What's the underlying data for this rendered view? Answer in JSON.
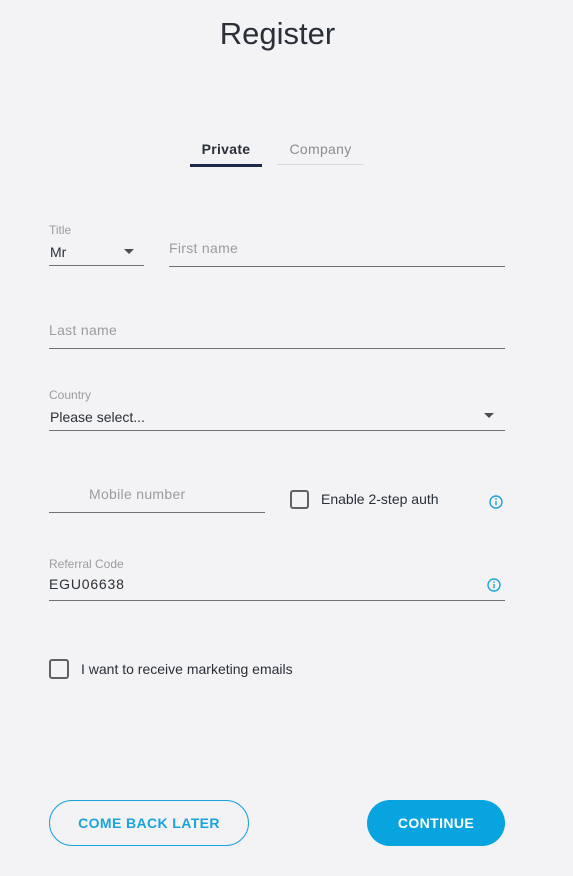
{
  "page": {
    "title": "Register"
  },
  "tabs": [
    {
      "label": "Private",
      "active": true
    },
    {
      "label": "Company",
      "active": false
    }
  ],
  "form": {
    "title_field": {
      "label": "Title",
      "value": "Mr"
    },
    "first_name": {
      "placeholder": "First name"
    },
    "last_name": {
      "placeholder": "Last name"
    },
    "country": {
      "label": "Country",
      "value": "Please select..."
    },
    "mobile": {
      "placeholder": "Mobile number"
    },
    "two_step": {
      "label": "Enable 2-step auth",
      "checked": false,
      "icon": "info-icon"
    },
    "referral": {
      "label": "Referral Code",
      "value": "EGU06638",
      "icon": "info-icon"
    },
    "marketing": {
      "label": "I want to receive marketing emails",
      "checked": false
    }
  },
  "actions": {
    "back_label": "COME BACK LATER",
    "continue_label": "CONTINUE"
  },
  "colors": {
    "accent": "#07a4e0",
    "tab_active": "#1d2a4a",
    "background": "#f3f3f5"
  }
}
